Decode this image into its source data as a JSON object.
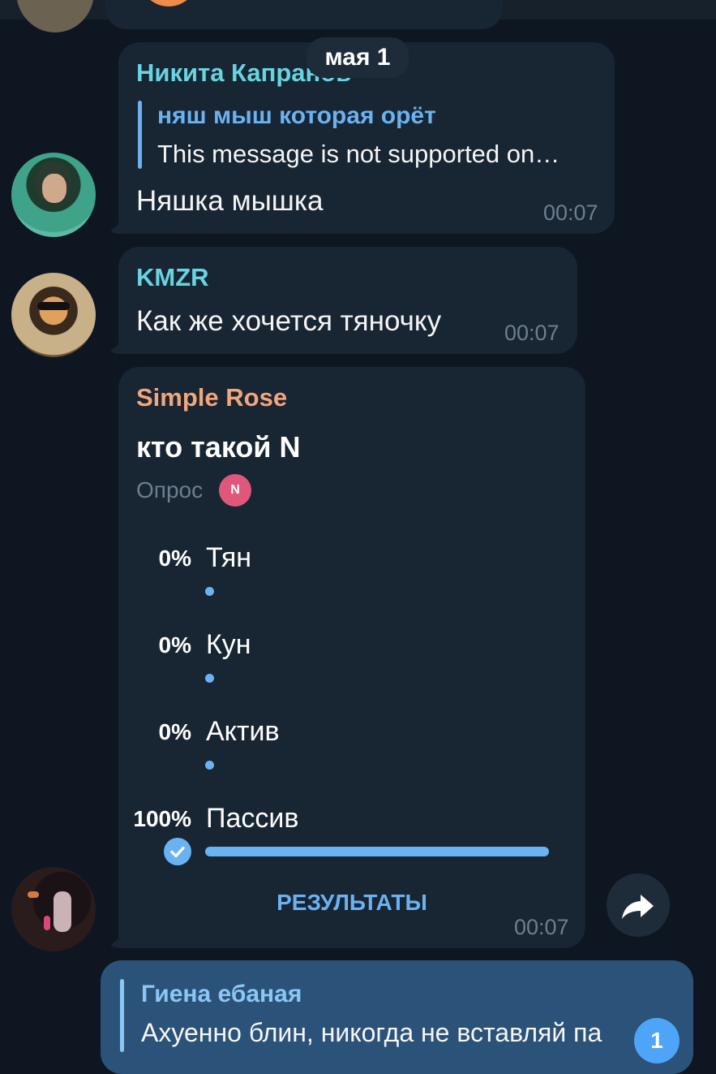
{
  "date_pill": "мая 1",
  "messages": [
    {
      "sender": "Никита Капранов",
      "reply": {
        "author": "няш мыш которая орёт",
        "text": "This message is not supported on…"
      },
      "text": "Няшка мышка",
      "time": "00:07"
    },
    {
      "sender": "KMZR",
      "text": "Как же хочется тяночку",
      "time": "00:07"
    }
  ],
  "poll": {
    "sender": "Simple Rose",
    "question": "кто такой N",
    "type_label": "Опрос",
    "voter_initial": "N",
    "options": [
      {
        "percent": "0%",
        "label": "Тян",
        "fraction": 0
      },
      {
        "percent": "0%",
        "label": "Кун",
        "fraction": 0
      },
      {
        "percent": "0%",
        "label": "Актив",
        "fraction": 0
      },
      {
        "percent": "100%",
        "label": "Пассив",
        "fraction": 1
      }
    ],
    "results_label": "РЕЗУЛЬТАТЫ",
    "time": "00:07"
  },
  "outgoing": {
    "reply_author": "Гиена ебаная",
    "reply_text": "Ахуенно блин, никогда не вставляй па",
    "badge": "1"
  },
  "colors": {
    "background": "#0e1621",
    "bubble_in": "#182533",
    "bubble_out": "#2b5278",
    "accent_blue": "#6ab2f2",
    "name_teal": "#67d4e0",
    "name_orange": "#f2a67a"
  },
  "icons": {
    "forward": "forward-arrow-icon",
    "vote_check": "check-circle-icon"
  }
}
